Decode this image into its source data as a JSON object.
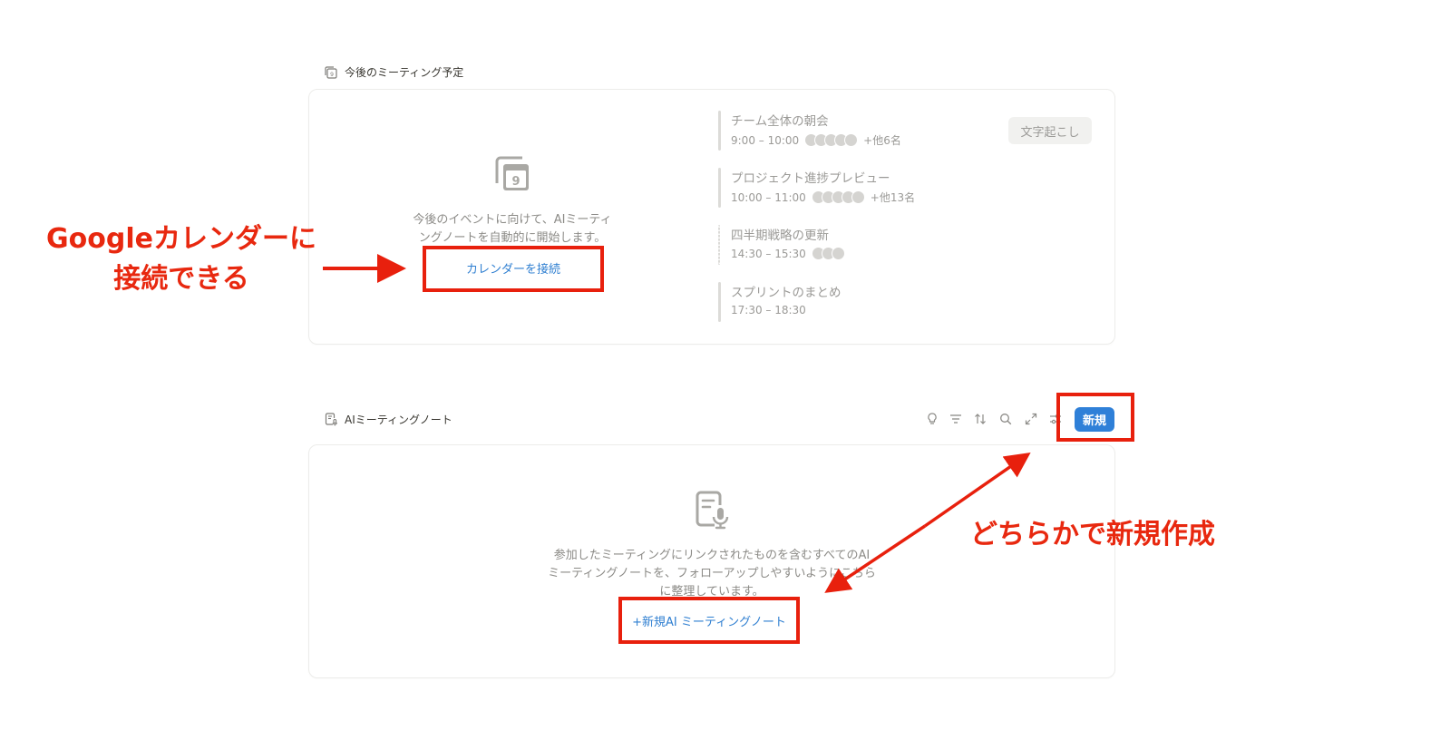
{
  "upcoming": {
    "header": "今後のミーティング予定",
    "empty_text_line1": "今後のイベントに向けて、AIミーティ",
    "empty_text_line2": "ングノートを自動的に開始します。",
    "connect_label": "カレンダーを接続",
    "calendar_day": "9",
    "transcribe_label": "文字起こし",
    "events": [
      {
        "title": "チーム全体の朝会",
        "time": "9:00 – 10:00",
        "extra": "+他6名"
      },
      {
        "title": "プロジェクト進捗プレビュー",
        "time": "10:00 – 11:00",
        "extra": "+他13名"
      },
      {
        "title": "四半期戦略の更新",
        "time": "14:30 – 15:30",
        "extra": ""
      },
      {
        "title": "スプリントのまとめ",
        "time": "17:30 – 18:30",
        "extra": ""
      }
    ]
  },
  "notes": {
    "header": "AIミーティングノート",
    "new_label": "新規",
    "empty_line1": "参加したミーティングにリンクされたものを含むすべてのAI",
    "empty_line2": "ミーティングノートを、フォローアップしやすいようにこちら",
    "empty_line3": "に整理しています。",
    "new_note_label": "+新規AI ミーティングノート"
  },
  "annotations": {
    "left_line1": "Googleカレンダーに",
    "left_line2": "接続できる",
    "right": "どちらかで新規作成"
  },
  "colors": {
    "accent": "#2f80d8",
    "annotation": "#e8200d"
  }
}
